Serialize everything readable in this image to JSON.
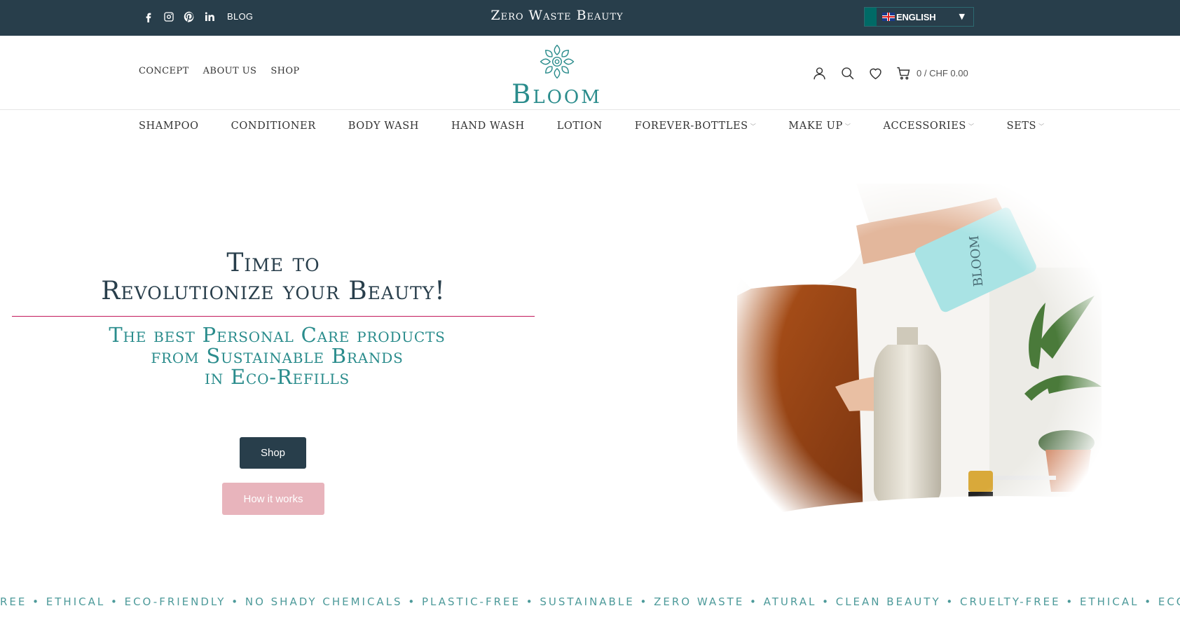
{
  "topbar": {
    "social": [
      "facebook-icon",
      "instagram-icon",
      "pinterest-icon",
      "linkedin-icon"
    ],
    "blog_label": "BLOG",
    "title": "Zero Waste Beauty",
    "language": "ENGLISH"
  },
  "header": {
    "nav": [
      "CONCEPT",
      "ABOUT US",
      "SHOP"
    ],
    "logo_text": "Bloom",
    "cart_text": "0 / CHF 0.00"
  },
  "categories": [
    {
      "label": "SHAMPOO",
      "has_dropdown": false
    },
    {
      "label": "CONDITIONER",
      "has_dropdown": false
    },
    {
      "label": "BODY WASH",
      "has_dropdown": false
    },
    {
      "label": "HAND WASH",
      "has_dropdown": false
    },
    {
      "label": "LOTION",
      "has_dropdown": false
    },
    {
      "label": "FOREVER-BOTTLES",
      "has_dropdown": true
    },
    {
      "label": "MAKE UP",
      "has_dropdown": true
    },
    {
      "label": "ACCESSORIES",
      "has_dropdown": true
    },
    {
      "label": "SETS",
      "has_dropdown": true
    }
  ],
  "hero": {
    "title_line1": "Time to",
    "title_line2": "Revolutionize your Beauty!",
    "sub_line1": "The best Personal Care products",
    "sub_line2": "from Sustainable Brands",
    "sub_line3": "in Eco-Refills",
    "shop_label": "Shop",
    "how_label": "How it works"
  },
  "ticker": {
    "items": [
      "REE",
      "ETHICAL",
      "ECO-FRIENDLY",
      "NO SHADY CHEMICALS",
      "PLASTIC-FREE",
      "SUSTAINABLE",
      "ZERO WASTE",
      "ATURAL",
      "CLEAN BEAUTY",
      "CRUELTY-FREE",
      "ETHICAL",
      "ECO"
    ]
  },
  "colors": {
    "topbar": "#283e4b",
    "teal": "#2a8c8c",
    "pink_button": "#e8b4bc",
    "divider": "#c2185b"
  }
}
